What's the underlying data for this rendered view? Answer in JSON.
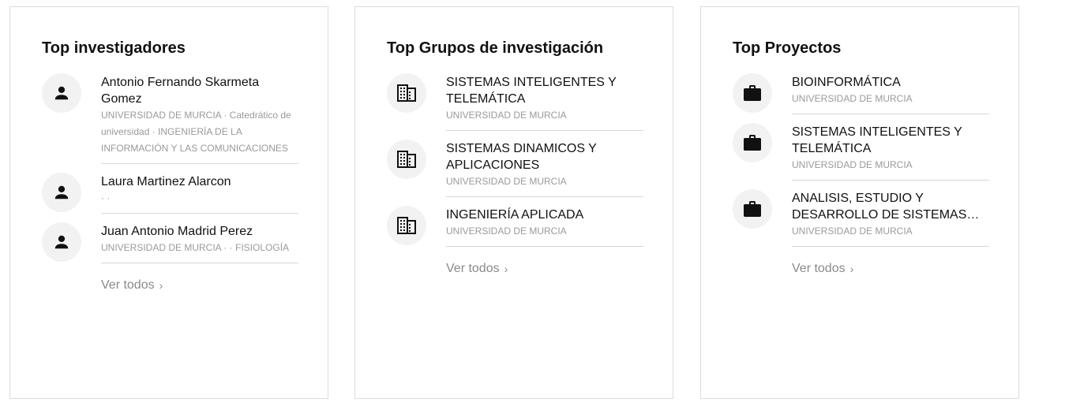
{
  "cards": [
    {
      "title": "Top investigadores",
      "icon": "person-icon",
      "items": [
        {
          "name": "Antonio Fernando Skarmeta Gomez",
          "subtitle": "UNIVERSIDAD DE MURCIA · Catedrático de universidad · INGENIERÍA DE LA INFORMACIÓN Y LAS COMUNICACIONES"
        },
        {
          "name": "Laura Martinez Alarcon",
          "subtitle": "· ·"
        },
        {
          "name": "Juan Antonio Madrid Perez",
          "subtitle": "UNIVERSIDAD DE MURCIA · · FISIOLOGÍA"
        }
      ],
      "more_label": "Ver todos"
    },
    {
      "title": "Top Grupos de investigación",
      "icon": "building-icon",
      "items": [
        {
          "name": "SISTEMAS INTELIGENTES Y TELEMÁTICA",
          "subtitle": "UNIVERSIDAD DE MURCIA"
        },
        {
          "name": "SISTEMAS DINAMICOS Y APLICACIONES",
          "subtitle": "UNIVERSIDAD DE MURCIA"
        },
        {
          "name": "INGENIERÍA APLICADA",
          "subtitle": "UNIVERSIDAD DE MURCIA"
        }
      ],
      "more_label": "Ver todos"
    },
    {
      "title": "Top Proyectos",
      "icon": "briefcase-icon",
      "items": [
        {
          "name": "BIOINFORMÁTICA",
          "subtitle": "UNIVERSIDAD DE MURCIA"
        },
        {
          "name": "SISTEMAS INTELIGENTES Y TELEMÁTICA",
          "subtitle": "UNIVERSIDAD DE MURCIA"
        },
        {
          "name": "ANALISIS, ESTUDIO Y DESARROLLO DE SISTEMAS…",
          "subtitle": "UNIVERSIDAD DE MURCIA"
        }
      ],
      "more_label": "Ver todos"
    }
  ]
}
